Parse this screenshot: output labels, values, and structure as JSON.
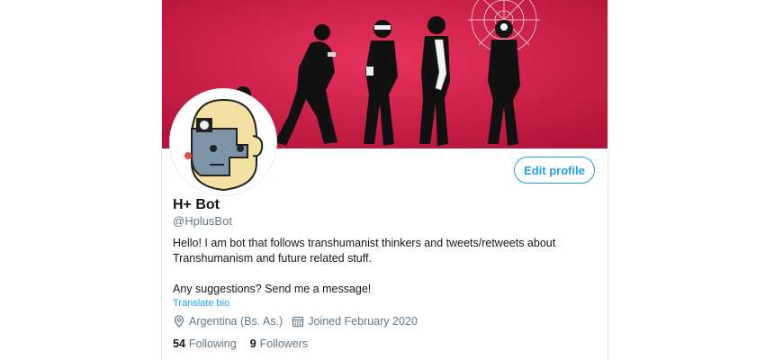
{
  "profile": {
    "name": "H+ Bot",
    "handle": "@HplusBot",
    "bio_line1": "Hello! I am bot that follows transhumanist thinkers and tweets/retweets about Transhumanism and future related stuff.",
    "bio_line2": "Any suggestions? Send me a message!",
    "translate_label": "Translate bio",
    "location": "Argentina (Bs. As.)",
    "joined": "Joined February 2020",
    "following_count": "54",
    "following_label": "Following",
    "followers_count": "9",
    "followers_label": "Followers"
  },
  "actions": {
    "edit_profile_label": "Edit profile"
  },
  "colors": {
    "banner": "#d91c48",
    "accent": "#1da1f2",
    "muted": "#657786",
    "text": "#14171a"
  },
  "icons": {
    "location": "location-pin-icon",
    "calendar": "calendar-icon"
  }
}
